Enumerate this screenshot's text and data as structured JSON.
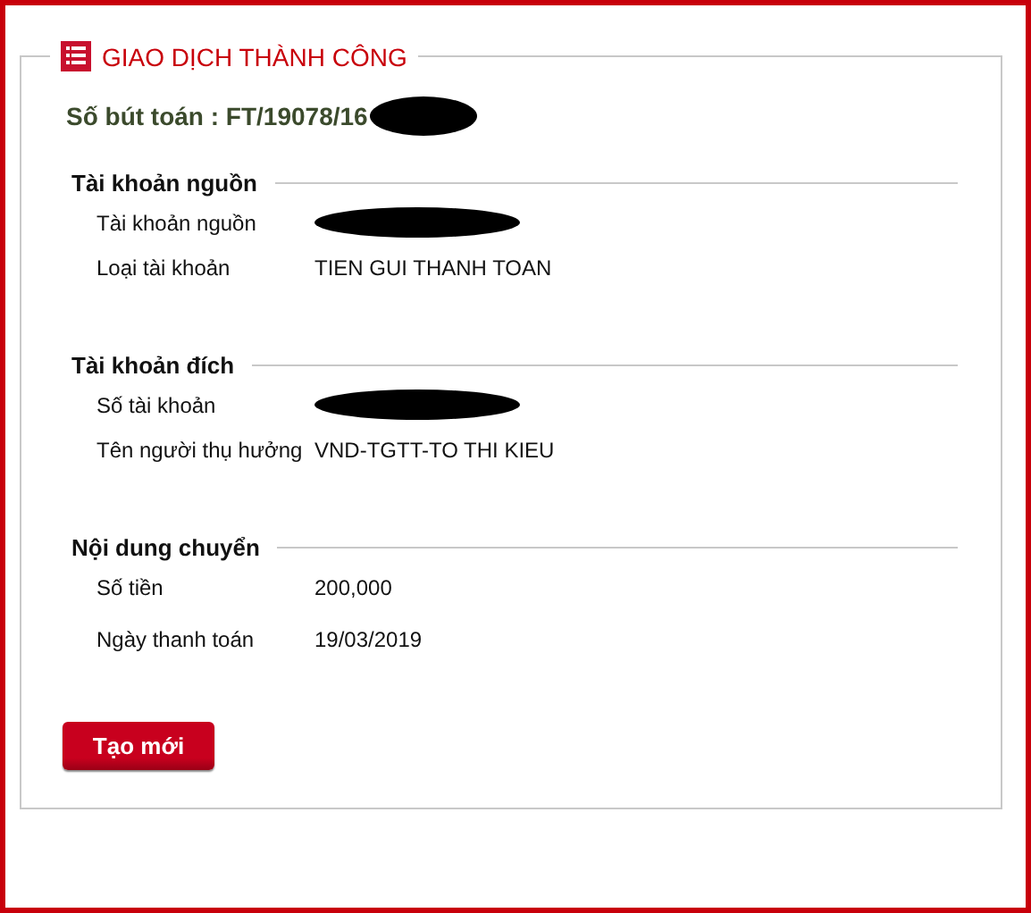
{
  "panel": {
    "title": "GIAO DỊCH THÀNH CÔNG"
  },
  "reference": {
    "text": "Số bút toán : FT/19078/16",
    "redacted": true
  },
  "sections": [
    {
      "heading": "Tài khoản nguồn",
      "rows": [
        {
          "label": "Tài khoản nguồn",
          "redacted": true
        },
        {
          "label": "Loại tài khoản",
          "value": "TIEN GUI THANH TOAN",
          "redacted": false
        }
      ]
    },
    {
      "heading": "Tài khoản đích",
      "rows": [
        {
          "label": "Số tài khoản",
          "redacted": true
        },
        {
          "label": "Tên người thụ hưởng",
          "value": "VND-TGTT-TO THI KIEU",
          "redacted": false
        }
      ]
    },
    {
      "heading": "Nội dung chuyển",
      "rows": [
        {
          "label": "Số tiền",
          "value": "200,000",
          "redacted": false
        },
        {
          "label": "Ngày thanh toán",
          "value": "19/03/2019",
          "redacted": false
        }
      ]
    }
  ],
  "button": {
    "label": "Tạo mới"
  }
}
